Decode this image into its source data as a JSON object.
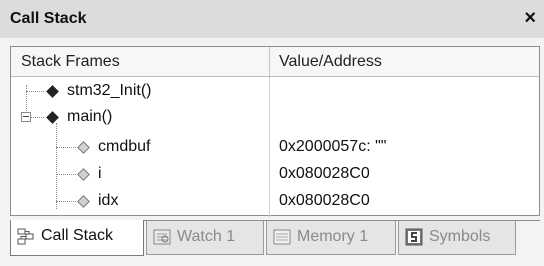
{
  "window": {
    "title": "Call Stack",
    "close_label": "×"
  },
  "columns": {
    "stack_frames": "Stack Frames",
    "value_address": "Value/Address"
  },
  "rows": [
    {
      "name": "stm32_Init()",
      "value": ""
    },
    {
      "name": "main()",
      "value": ""
    },
    {
      "name": "cmdbuf",
      "value": "0x2000057c: \"\""
    },
    {
      "name": "i",
      "value": "0x080028C0"
    },
    {
      "name": "idx",
      "value": "0x080028C0"
    }
  ],
  "tabs": [
    {
      "label": "Call Stack",
      "icon": "call-stack-icon",
      "active": true
    },
    {
      "label": "Watch 1",
      "icon": "watch-icon",
      "active": false
    },
    {
      "label": "Memory 1",
      "icon": "memory-icon",
      "active": false
    },
    {
      "label": "Symbols",
      "icon": "symbols-icon",
      "active": false
    }
  ],
  "colors": {
    "titlebar_bg": "#dcdcdc",
    "panel_bg": "#ffffff",
    "tab_active_bg": "#ffffff",
    "tab_inactive_bg": "#e5e5e5"
  }
}
